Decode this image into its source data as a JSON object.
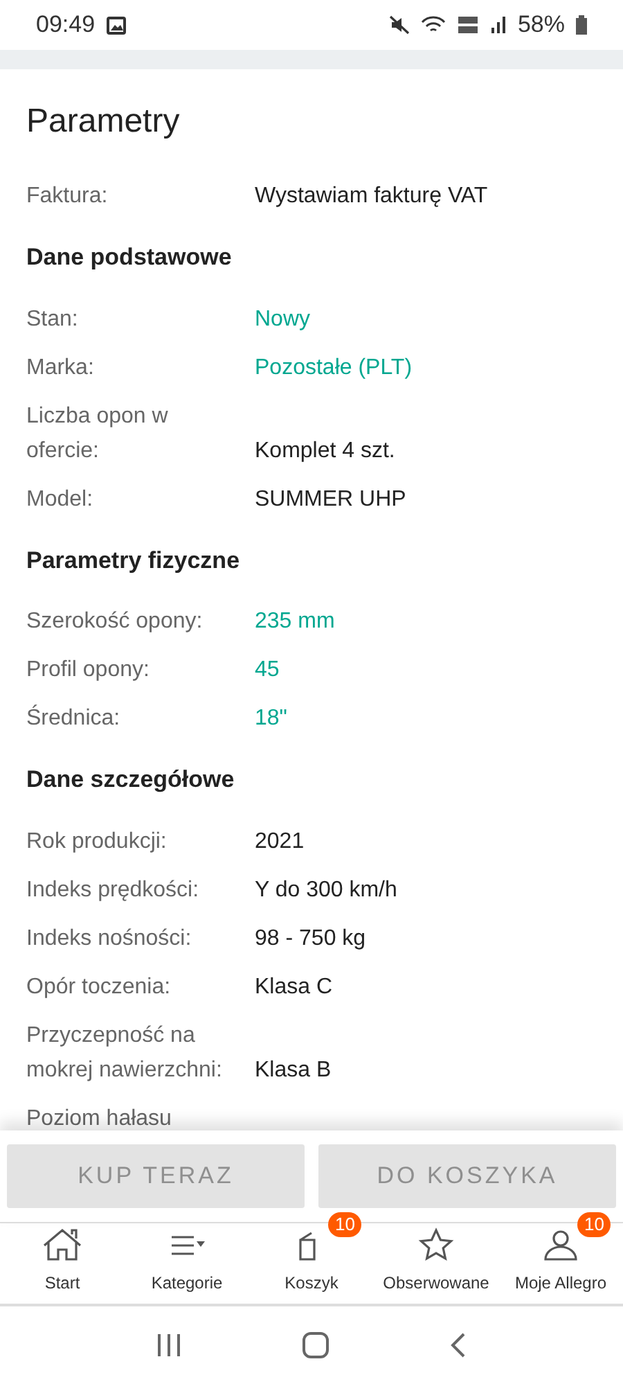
{
  "status_bar": {
    "time": "09:49",
    "battery": "58%"
  },
  "title": "Parametry",
  "top_rows": [
    {
      "label": "Faktura:",
      "value": "Wystawiam fakturę VAT",
      "linked": false
    }
  ],
  "sections": [
    {
      "heading": "Dane podstawowe",
      "rows": [
        {
          "label": "Stan:",
          "value": "Nowy",
          "linked": true
        },
        {
          "label": "Marka:",
          "value": "Pozostałe (PLT)",
          "linked": true
        },
        {
          "label": "Liczba opon w ofercie:",
          "value": "Komplet 4 szt.",
          "linked": false
        },
        {
          "label": "Model:",
          "value": "SUMMER UHP",
          "linked": false
        }
      ]
    },
    {
      "heading": "Parametry fizyczne",
      "rows": [
        {
          "label": "Szerokość opony:",
          "value": "235 mm",
          "linked": true
        },
        {
          "label": "Profil opony:",
          "value": "45",
          "linked": true
        },
        {
          "label": "Średnica:",
          "value": "18\"",
          "linked": true
        }
      ]
    },
    {
      "heading": "Dane szczegółowe",
      "rows": [
        {
          "label": "Rok produkcji:",
          "value": "2021",
          "linked": false
        },
        {
          "label": "Indeks prędkości:",
          "value": "Y do 300 km/h",
          "linked": false
        },
        {
          "label": "Indeks nośności:",
          "value": "98 - 750 kg",
          "linked": false
        },
        {
          "label": "Opór toczenia:",
          "value": "Klasa C",
          "linked": false
        },
        {
          "label": "Przyczepność na mokrej nawierzchni:",
          "value": "Klasa B",
          "linked": false
        },
        {
          "label": "Poziom hałasu"
        }
      ]
    }
  ],
  "actions": [
    {
      "label": "KUP TERAZ",
      "disabled": true
    },
    {
      "label": "DO KOSZYKA",
      "disabled": true
    }
  ],
  "tabs": [
    {
      "kind": "home",
      "label": "Start"
    },
    {
      "kind": "categories",
      "label": "Kategorie"
    },
    {
      "kind": "cart",
      "label": "Koszyk",
      "badge": "10"
    },
    {
      "kind": "star",
      "label": "Obserwowane"
    },
    {
      "kind": "user",
      "label": "Moje Allegro",
      "badge": "10"
    }
  ]
}
